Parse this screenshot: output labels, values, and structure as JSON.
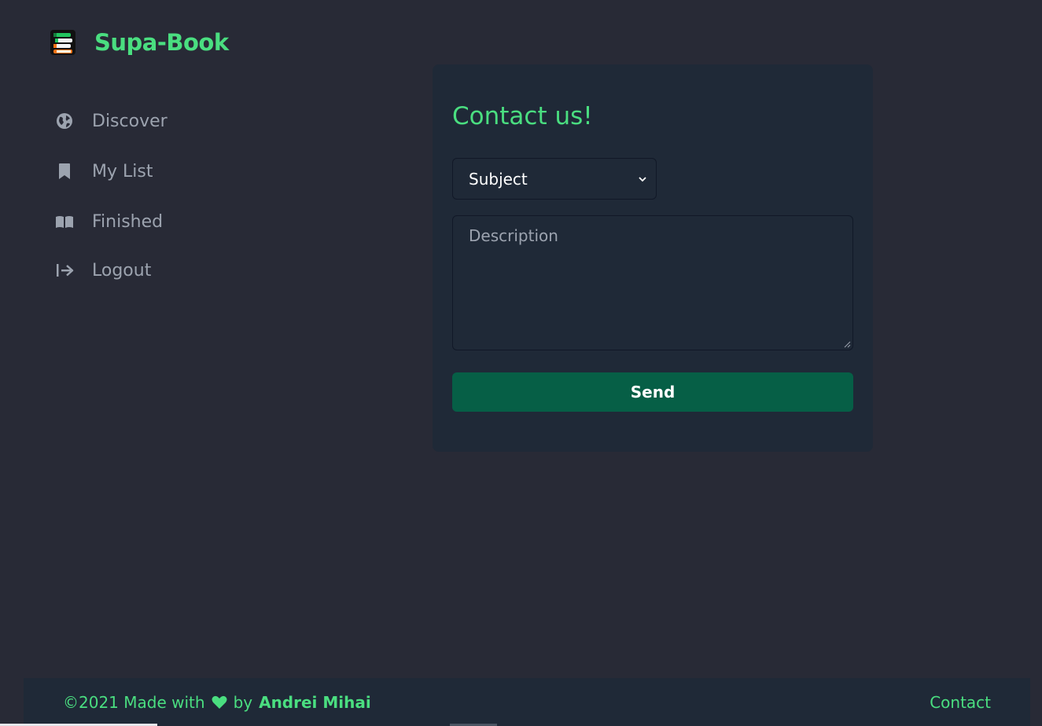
{
  "brand": {
    "name": "Supa-Book",
    "logo_icon": "books-stack-icon"
  },
  "nav": {
    "items": [
      {
        "label": "Discover",
        "icon": "globe-icon"
      },
      {
        "label": "My List",
        "icon": "bookmark-icon"
      },
      {
        "label": "Finished",
        "icon": "open-book-icon"
      },
      {
        "label": "Logout",
        "icon": "logout-arrow-icon"
      }
    ]
  },
  "contact_form": {
    "title": "Contact us!",
    "subject_value": "Subject",
    "description_placeholder": "Description",
    "send_label": "Send"
  },
  "footer": {
    "made_with_prefix": "©2021 Made with",
    "by_text": "by",
    "author": "Andrei Mihai",
    "contact_label": "Contact"
  },
  "colors": {
    "background": "#282a36",
    "panel": "#1f2937",
    "accent_green": "#4ade80",
    "button_green": "#065f46",
    "muted_text": "#9ca3af"
  }
}
